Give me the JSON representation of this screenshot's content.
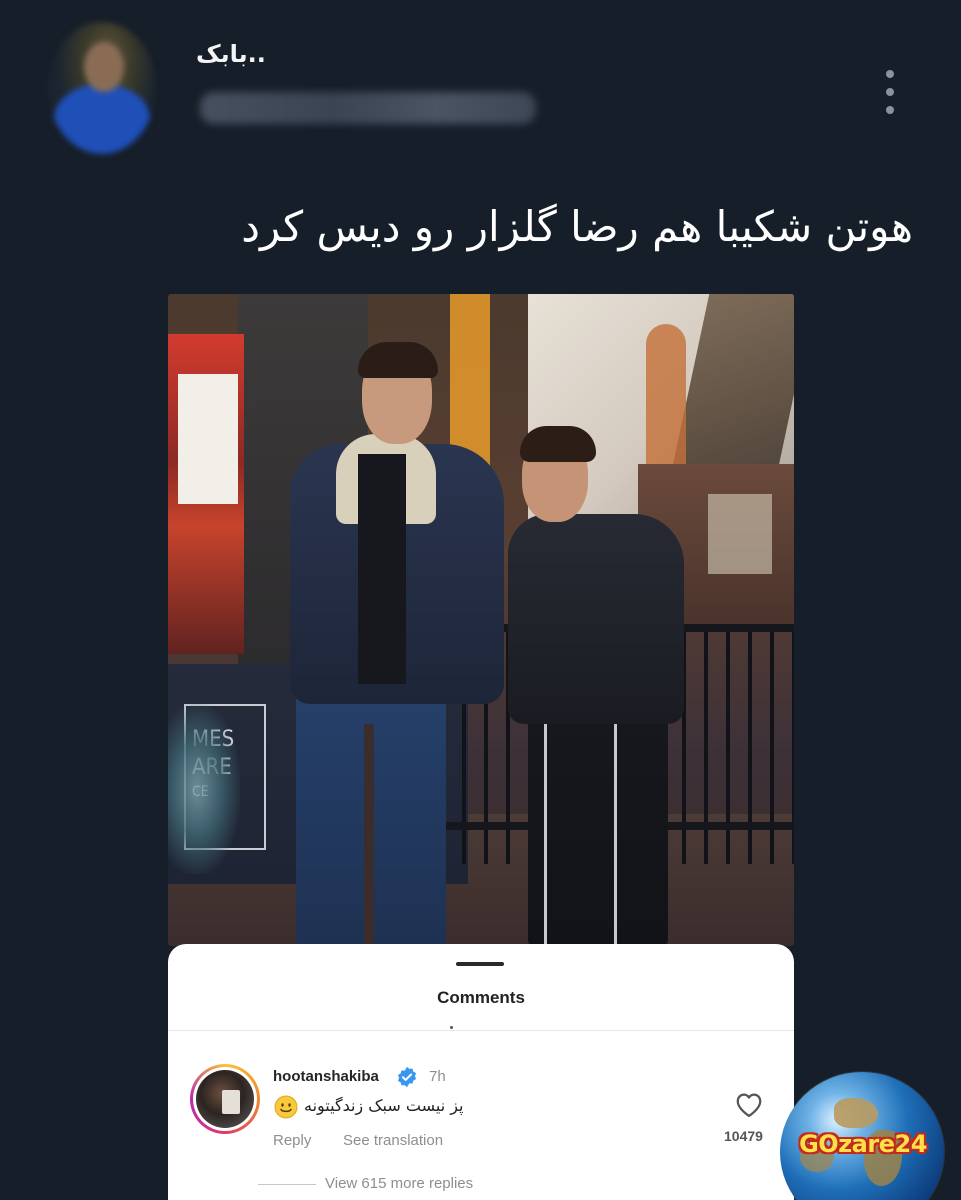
{
  "post": {
    "author_name": "بابک..",
    "text": "هوتن شکیبا هم رضا گلزار رو دیس کرد"
  },
  "photo": {
    "sign_lines": [
      "MES",
      "ARE",
      "CE"
    ]
  },
  "comments_sheet": {
    "title": "Comments",
    "comment": {
      "username": "hootanshakiba",
      "verified": true,
      "time": "7h",
      "text": "پز نیست سبک زندگیتونه",
      "emoji": "smiling-face",
      "reply_label": "Reply",
      "translate_label": "See translation",
      "likes": "10479"
    },
    "view_replies": "View 615 more replies"
  },
  "watermark": {
    "text": "GOzare24"
  },
  "colors": {
    "background": "#161e29",
    "verified_blue": "#3897f0",
    "watermark_yellow": "#ffe04a"
  }
}
